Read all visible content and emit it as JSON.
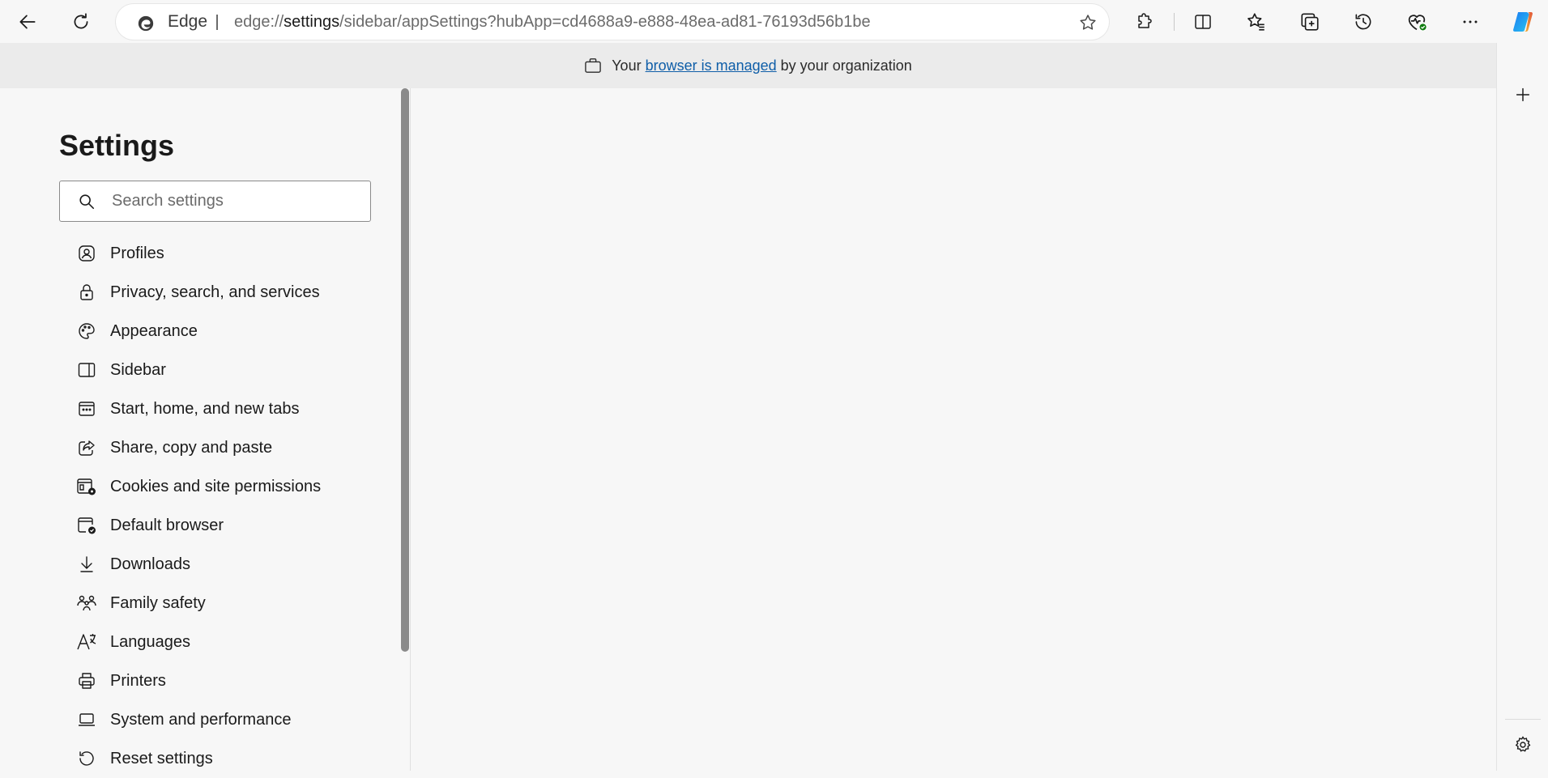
{
  "toolbar": {
    "back_icon": "arrow-left-icon",
    "refresh_icon": "refresh-icon",
    "favorite_icon": "star-outline-icon",
    "buttons": [
      "extensions-icon",
      "split-screen-icon",
      "favorites-icon",
      "collections-icon",
      "history-icon",
      "browser-essentials-icon",
      "more-icon",
      "copilot-icon"
    ]
  },
  "omnibox": {
    "site_label": "Edge",
    "url_prefix": "edge://",
    "url_host": "settings",
    "url_path": "/sidebar/appSettings?hubApp=cd4688a9-e888-48ea-ad81-76193d56b1be"
  },
  "infobar": {
    "prefix": "Your",
    "link": "browser is managed",
    "suffix": "by your organization"
  },
  "settings": {
    "title": "Settings",
    "search_placeholder": "Search settings",
    "nav_items": [
      {
        "label": "Profiles",
        "icon": "profile-icon"
      },
      {
        "label": "Privacy, search, and services",
        "icon": "lock-icon"
      },
      {
        "label": "Appearance",
        "icon": "palette-icon"
      },
      {
        "label": "Sidebar",
        "icon": "sidebar-icon"
      },
      {
        "label": "Start, home, and new tabs",
        "icon": "home-tabs-icon"
      },
      {
        "label": "Share, copy and paste",
        "icon": "share-icon"
      },
      {
        "label": "Cookies and site permissions",
        "icon": "cookies-icon"
      },
      {
        "label": "Default browser",
        "icon": "default-browser-icon"
      },
      {
        "label": "Downloads",
        "icon": "download-icon"
      },
      {
        "label": "Family safety",
        "icon": "family-icon"
      },
      {
        "label": "Languages",
        "icon": "languages-icon"
      },
      {
        "label": "Printers",
        "icon": "printer-icon"
      },
      {
        "label": "System and performance",
        "icon": "laptop-icon"
      },
      {
        "label": "Reset settings",
        "icon": "reset-icon"
      }
    ]
  },
  "edge_sidebar": {
    "add_icon": "plus-icon",
    "settings_icon": "gear-icon"
  },
  "colors": {
    "accent_link": "#0f5ea8",
    "background": "#f7f7f7",
    "infobar": "#ebebeb"
  }
}
